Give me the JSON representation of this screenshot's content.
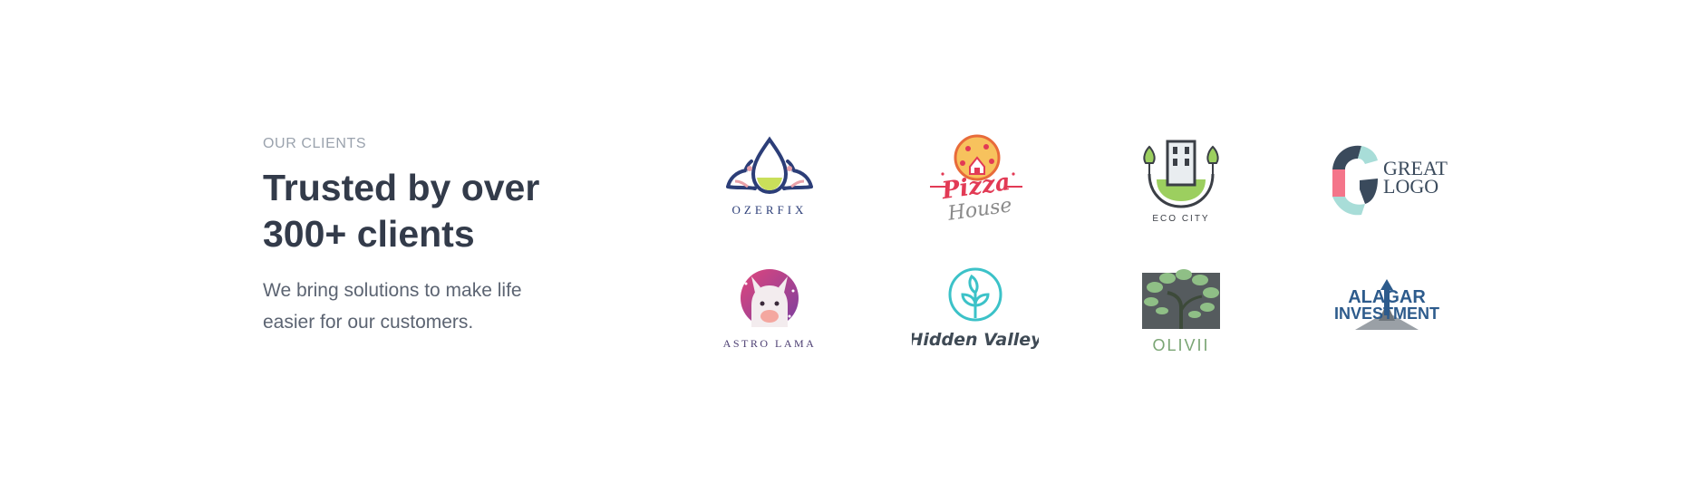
{
  "clients": {
    "eyebrow": "OUR CLIENTS",
    "headline": "Trusted by over 300+ clients",
    "subtext": "We bring solutions to make life easier for our customers.",
    "logos": [
      {
        "name": "ozerfix",
        "text": "OZERFIX"
      },
      {
        "name": "pizza-house",
        "text": "Pizza",
        "text2": "House"
      },
      {
        "name": "eco-city",
        "text": "ECO CITY"
      },
      {
        "name": "great-logo",
        "text": "GREAT",
        "text2": "LOGO"
      },
      {
        "name": "astro-lama",
        "text": "ASTRO LAMA"
      },
      {
        "name": "hidden-valley",
        "text": "Hidden Valley"
      },
      {
        "name": "olivii",
        "text": "OLIVII"
      },
      {
        "name": "alagar-investment",
        "text": "ALAGAR",
        "text2": "INVESTMENT"
      }
    ]
  },
  "colors": {
    "heading": "#333b4a",
    "muted": "#9aa2ad",
    "body": "#5c6472",
    "navy": "#2c3e78",
    "pizza_red": "#e23a55",
    "eco_green": "#9ccf5f",
    "teal": "#3cc2c8",
    "olive_green": "#7aa574",
    "alagar_blue": "#2d5b8c"
  }
}
